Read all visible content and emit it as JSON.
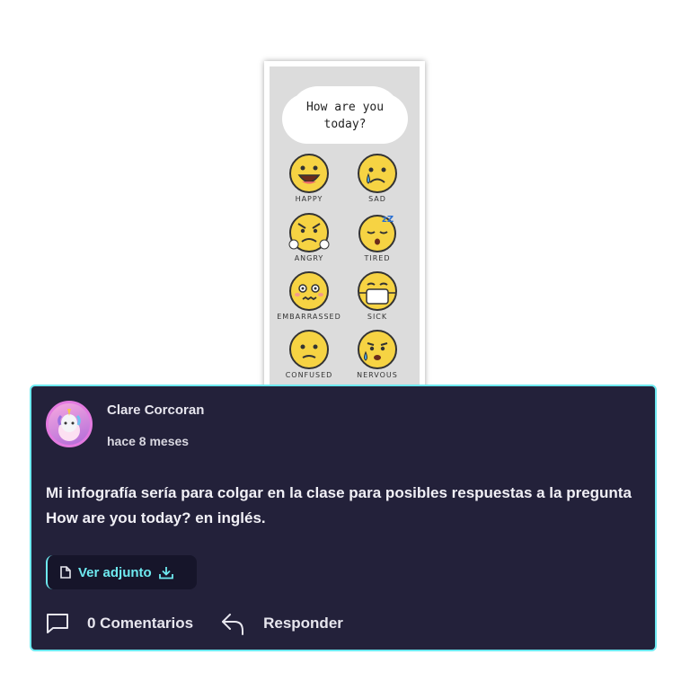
{
  "infographic": {
    "title_line1": "How are you",
    "title_line2": "today?",
    "emotions": [
      {
        "label": "HAPPY"
      },
      {
        "label": "SAD"
      },
      {
        "label": "ANGRY"
      },
      {
        "label": "TIRED"
      },
      {
        "label": "EMBARRASSED"
      },
      {
        "label": "SICK"
      },
      {
        "label": "CONFUSED"
      },
      {
        "label": "NERVOUS"
      }
    ]
  },
  "comment": {
    "author": "Clare Corcoran",
    "time": "hace 8 meses",
    "body": "Mi infografía sería para colgar en la clase para posibles respuestas a la pregunta How are you today? en inglés.",
    "attachment_label": "Ver adjunto",
    "comments_label": "0 Comentarios",
    "reply_label": "Responder"
  },
  "colors": {
    "card_bg": "#23213a",
    "card_border": "#6ee9f0",
    "accent": "#6ee9f0",
    "emoji_yellow": "#f6d343"
  },
  "icons": [
    "file-icon",
    "download-icon",
    "comment-bubble-icon",
    "reply-arrow-icon"
  ]
}
